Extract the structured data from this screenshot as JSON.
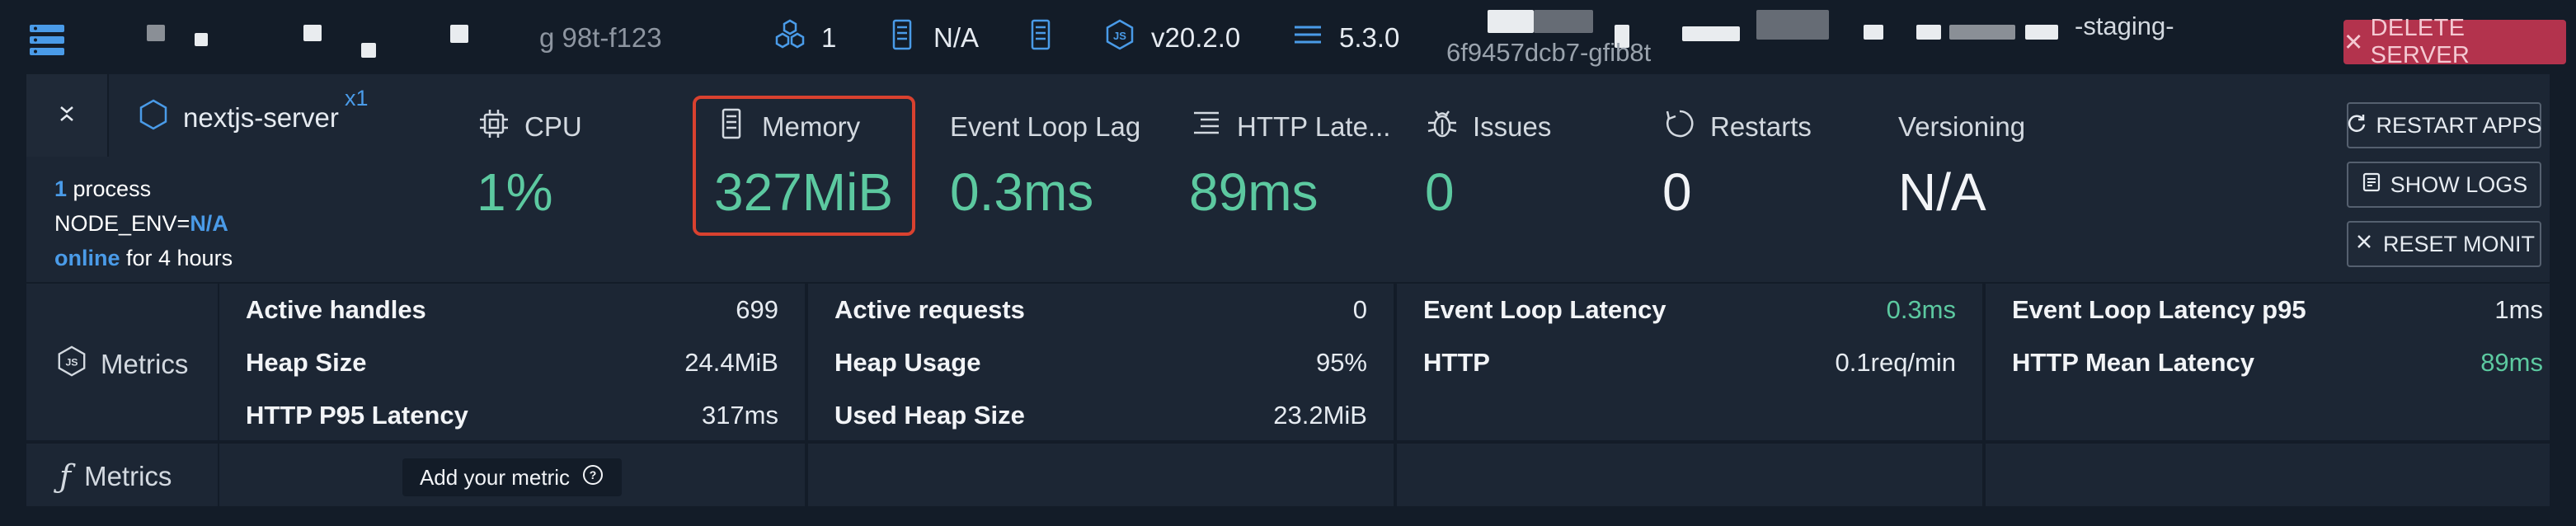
{
  "topbar": {
    "host_partial": "g  98t-f123",
    "instances": "1",
    "server_label": "N/A",
    "node_version": "v20.2.0",
    "pm2_version": "5.3.0",
    "hash": "6f9457dcb7-gfib8t",
    "staging": "-staging-",
    "delete_label": "DELETE SERVER"
  },
  "process": {
    "name": "nextjs-server",
    "multiplier": "x1",
    "count": "1",
    "process_word": " process",
    "env_key": "NODE_ENV=",
    "env_val": "N/A",
    "status": "online",
    "uptime": " for 4 hours"
  },
  "metrics": {
    "cpu": {
      "label": "CPU",
      "value": "1%"
    },
    "memory": {
      "label": "Memory",
      "value": "327MiB"
    },
    "loop_lag": {
      "label": "Event Loop Lag",
      "value": "0.3ms"
    },
    "http_lat": {
      "label": "HTTP Late...",
      "value": "89ms"
    },
    "issues": {
      "label": "Issues",
      "value": "0"
    },
    "restarts": {
      "label": "Restarts",
      "value": "0"
    },
    "versioning": {
      "label": "Versioning",
      "value": "N/A"
    }
  },
  "actions": {
    "restart": "RESTART APPS",
    "logs": "SHOW LOGS",
    "reset": "RESET MONIT"
  },
  "grid": {
    "row1_label": "Metrics",
    "row2_label": "Metrics",
    "add_metric": "Add your metric",
    "col1": [
      {
        "k": "Active handles",
        "v": "699"
      },
      {
        "k": "Heap Size",
        "v": "24.4MiB"
      },
      {
        "k": "HTTP P95 Latency",
        "v": "317ms"
      }
    ],
    "col2": [
      {
        "k": "Active requests",
        "v": "0"
      },
      {
        "k": "Heap Usage",
        "v": "95%"
      },
      {
        "k": "Used Heap Size",
        "v": "23.2MiB"
      }
    ],
    "col3": [
      {
        "k": "Event Loop Latency",
        "v": "0.3ms"
      },
      {
        "k": "HTTP",
        "v": "0.1req/min"
      }
    ],
    "col4": [
      {
        "k": "Event Loop Latency p95",
        "v": "1ms"
      },
      {
        "k": "HTTP Mean Latency",
        "v": "89ms"
      }
    ]
  },
  "colors": {
    "accent": "#4a9be8",
    "value_green": "#5cc9a0",
    "danger": "#b3334d",
    "highlight": "#d9412f"
  }
}
